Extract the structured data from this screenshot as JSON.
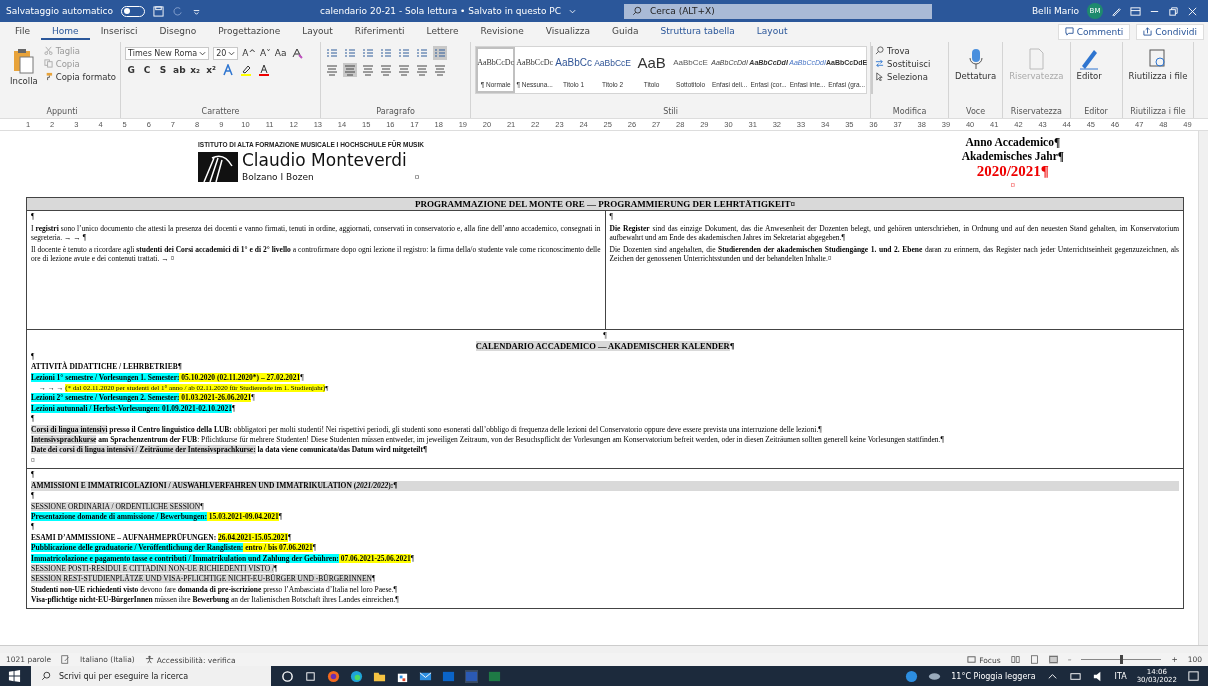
{
  "title_bar": {
    "autosave_label": "Salvataggio automatico",
    "autosave_on": false,
    "document_title": "calendario 20-21 - Sola lettura • Salvato in questo PC",
    "search_placeholder": "Cerca (ALT+X)",
    "user_name": "Belli Mario",
    "user_initials": "BM"
  },
  "tabs": [
    {
      "label": "File",
      "selected": false,
      "kind": "normal"
    },
    {
      "label": "Home",
      "selected": true,
      "kind": "normal"
    },
    {
      "label": "Inserisci",
      "selected": false,
      "kind": "normal"
    },
    {
      "label": "Disegno",
      "selected": false,
      "kind": "normal"
    },
    {
      "label": "Progettazione",
      "selected": false,
      "kind": "normal"
    },
    {
      "label": "Layout",
      "selected": false,
      "kind": "normal"
    },
    {
      "label": "Riferimenti",
      "selected": false,
      "kind": "normal"
    },
    {
      "label": "Lettere",
      "selected": false,
      "kind": "normal"
    },
    {
      "label": "Revisione",
      "selected": false,
      "kind": "normal"
    },
    {
      "label": "Visualizza",
      "selected": false,
      "kind": "normal"
    },
    {
      "label": "Guida",
      "selected": false,
      "kind": "normal"
    },
    {
      "label": "Struttura tabella",
      "selected": false,
      "kind": "contextual"
    },
    {
      "label": "Layout",
      "selected": false,
      "kind": "contextual"
    }
  ],
  "tab_actions": {
    "comments": "Commenti",
    "share": "Condividi"
  },
  "ribbon": {
    "clipboard": {
      "paste": "Incolla",
      "cut": "Taglia",
      "copy": "Copia",
      "format_painter": "Copia formato",
      "group": "Appunti"
    },
    "font": {
      "family": "Times New Roma",
      "size": "20",
      "grow": "A^",
      "shrink": "A˅",
      "case": "Aa",
      "format_buttons": [
        "G",
        "C",
        "S",
        "ab",
        "x₂",
        "x²"
      ],
      "group": "Carattere"
    },
    "paragraph": {
      "group": "Paragrafo"
    },
    "styles": {
      "group": "Stili",
      "items": [
        {
          "preview": "AaBbCcDc",
          "name": "¶ Normale",
          "selected": true,
          "kind": "serif"
        },
        {
          "preview": "AaBbCcDc",
          "name": "¶ Nessuna...",
          "selected": false,
          "kind": "serif"
        },
        {
          "preview": "AaBbCc",
          "name": "Titolo 1",
          "selected": false,
          "kind": "heading"
        },
        {
          "preview": "AaBbCcE",
          "name": "Titolo 2",
          "selected": false,
          "kind": "heading2"
        },
        {
          "preview": "AaB",
          "name": "Titolo",
          "selected": false,
          "kind": "title"
        },
        {
          "preview": "AaBbCcE",
          "name": "Sottotitolo",
          "selected": false,
          "kind": "subtitle"
        },
        {
          "preview": "AaBbCcDdI",
          "name": "Enfasi deli...",
          "selected": false,
          "kind": "italic"
        },
        {
          "preview": "AaBbCcDdI",
          "name": "Enfasi (cor...",
          "selected": false,
          "kind": "bolditalic"
        },
        {
          "preview": "AaBbCcDdI",
          "name": "Enfasi inte...",
          "selected": false,
          "kind": "intense"
        },
        {
          "preview": "AaBbCcDdE",
          "name": "Enfasi (gra...",
          "selected": false,
          "kind": "strong"
        }
      ]
    },
    "editing": {
      "group": "Modifica",
      "find": "Trova",
      "replace": "Sostituisci",
      "select": "Seleziona"
    },
    "big_buttons": [
      {
        "label": "Dettatura",
        "group": "Voce",
        "disabled": false,
        "kind": "mic"
      },
      {
        "label": "Riservatezza",
        "group": "Riservatezza",
        "disabled": true,
        "kind": "sensitivity"
      },
      {
        "label": "Editor",
        "group": "Editor",
        "disabled": false,
        "kind": "editor"
      },
      {
        "label": "Riutilizza i file",
        "group": "Riutilizza i file",
        "disabled": false,
        "kind": "reuse"
      }
    ]
  },
  "ruler": [
    "1",
    "2",
    "3",
    "4",
    "5",
    "6",
    "7",
    "8",
    "9",
    "10",
    "11",
    "12",
    "13",
    "14",
    "15",
    "16",
    "17",
    "18",
    "19",
    "20",
    "21",
    "22",
    "23",
    "24",
    "25",
    "26",
    "27",
    "28",
    "29",
    "30",
    "31",
    "32",
    "33",
    "34",
    "35",
    "36",
    "37",
    "38",
    "39",
    "40",
    "41",
    "42",
    "43",
    "44",
    "45",
    "46",
    "47",
    "48",
    "49"
  ],
  "document": {
    "header": {
      "institute": "ISTITUTO DI ALTA FORMAZIONE MUSICALE I HOCHSCHULE FÜR MUSIK",
      "logo_name": "Claudio Monteverdi",
      "logo_city": "Bolzano I Bozen",
      "cell_mark": "¤",
      "year_lines": [
        "Anno Accademico¶",
        "Akademisches Jahr¶"
      ],
      "year": "2020/2021¶",
      "year_cell_mark": "¤"
    },
    "table1": {
      "heading": "PROGRAMMAZIONE DEL MONTE ORE — PROGRAMMIERUNG DER LEHRTÄTIGKEIT¤",
      "left": [
        "¶",
        "I **registri** sono l’unico documento che attesti la presenza dei docenti e vanno firmati, tenuti in ordine, aggiornati, conservati in conservatorio e, alla fine dell’anno accademico, consegnati in segreteria. → → ¶",
        "Il docente è tenuto a ricordare agli **studenti dei Corsi accademici di 1° e di 2° livello** a controfirmare dopo ogni lezione il registro: la firma della/o studente vale come riconoscimento delle ore di lezione avute e dei contenuti trattati. → ¤"
      ],
      "right": [
        "¶",
        "**Die Register** sind das einzige Dokument, das die Anwesenheit der Dozenten belegt, und gehören unterschrieben, in Ordnung und auf den neuesten Stand gehalten, im Konservatorium aufbewahrt und am Ende des akademischen Jahres im Sekretariat abgegeben.¶",
        "Die Dozenten sind angehalten, die **Studierenden der akademischen Studiengänge 1. und 2. Ebene** daran zu erinnern, das Register nach jeder Unterrichtseinheit gegenzuzeichnen, als Zeichen der genossenen Unterrichtsstunden und der behandelten Inhalte.¤"
      ]
    },
    "sections": [
      {
        "lines": [
          {
            "kind": "center",
            "segments": [
              {
                "text": "¶"
              }
            ]
          },
          {
            "kind": "title",
            "segments": [
              {
                "text": "**CALENDARIO ACCADEMICO — AKADEMISCHER KALENDER**",
                "color": "#d9d9d9"
              },
              {
                "text": "**¶**"
              }
            ]
          },
          {
            "kind": "body",
            "segments": [
              {
                "text": "¶"
              }
            ]
          },
          {
            "kind": "body",
            "segments": [
              {
                "text": "**ATTIVITÀ DIDATTICHE / LEHRBETRIEB¶**"
              }
            ]
          },
          {
            "kind": "body",
            "segments": [
              {
                "text": "**Lezioni 1° semestre / Vorlesungen 1. Semester:**",
                "color": "#00ffff"
              },
              {
                "text": " **05.10.2020 (02.11.2020*) – 27.02.2021**",
                "color": "#ffff00"
              },
              {
                "text": "¶"
              }
            ]
          },
          {
            "kind": "note",
            "segments": [
              {
                "text": "→ → → "
              },
              {
                "text": "(* dal 02.11.2020 per studenti del 1° anno / ab 02.11.2020 für Studierende im 1. Studienjahr)",
                "color": "#ffff00"
              },
              {
                "text": "¶"
              }
            ]
          },
          {
            "kind": "body",
            "segments": [
              {
                "text": "**Lezioni 2° semestre / Vorlesungen 2. Semester:**",
                "color": "#00ffff"
              },
              {
                "text": " **01.03.2021-26.06.2021**",
                "color": "#ffff00"
              },
              {
                "text": "¶"
              }
            ]
          },
          {
            "kind": "body",
            "segments": [
              {
                "text": "**Lezioni autunnali / Herbst-Vorlesungen: 01.09.2021-02.10.2021**",
                "color": "#00ffff"
              },
              {
                "text": "¶"
              }
            ]
          },
          {
            "kind": "body",
            "segments": [
              {
                "text": "¶"
              }
            ]
          },
          {
            "kind": "body",
            "segments": [
              {
                "text": "**Corsi di lingua intensivi**",
                "color": "#d9d9d9"
              },
              {
                "text": " **presso il Centro linguistico della LUB:** obbligatori per molti studenti! Nei rispettivi periodi, gli studenti sono esonerati dall’obbligo di frequenza delle lezioni del Conservatorio oppure deve essere prevista una interruzione delle lezioni.¶"
              }
            ]
          },
          {
            "kind": "body",
            "segments": [
              {
                "text": "**Intensivsprachkurse**",
                "color": "#d9d9d9"
              },
              {
                "text": " **am Sprachenzentrum der FUB**: Pflichtkurse für mehrere Studenten! Diese Studenten müssen entweder, im jeweiligen Zeitraum, von der Besuchspflicht der Vorlesungen am Konservatorium befreit werden, oder in diesen Zeiträumen sollten generell keine Vorlesungen stattfinden.¶"
              }
            ]
          },
          {
            "kind": "body",
            "segments": [
              {
                "text": "**Date dei corsi di lingua intensivi / Zeiträume der Intensivsprachkurse:**",
                "color": "#d9d9d9"
              },
              {
                "text": " **la data viene comunicata/das Datum wird mitgeteilt¶**"
              }
            ]
          },
          {
            "kind": "body",
            "segments": [
              {
                "text": "¤"
              }
            ]
          }
        ]
      },
      {
        "lines": [
          {
            "kind": "body",
            "segments": [
              {
                "text": "¶"
              }
            ]
          },
          {
            "kind": "banner",
            "segments": [
              {
                "text": "**AMMISSIONI E IMMATRICOLAZIONI / AUSWAHLVERFAHREN UND IMMATRIKULATION (*2021/2022*):¶**",
                "color": "#d9d9d9"
              }
            ]
          },
          {
            "kind": "body",
            "segments": [
              {
                "text": "¶"
              }
            ]
          },
          {
            "kind": "body",
            "segments": [
              {
                "text": "SESSIONE ORDINARIA / ORDENTLICHE SESSION",
                "color": "#d9d9d9"
              },
              {
                "text": "¶"
              }
            ]
          },
          {
            "kind": "body",
            "segments": [
              {
                "text": "**Presentazione domande di ammissione / Bewerbungen:**",
                "color": "#00ffff"
              },
              {
                "text": " **15.03.2021-09.04.2021**",
                "color": "#ffff00"
              },
              {
                "text": "¶"
              }
            ]
          },
          {
            "kind": "body",
            "segments": [
              {
                "text": "¶"
              }
            ]
          },
          {
            "kind": "body",
            "segments": [
              {
                "text": "**ESAMI D’AMMISSIONE – AUFNAHMEPRÜFUNGEN:** "
              },
              {
                "text": "**26.04.2021-15.05.2021**",
                "color": "#ffff00"
              },
              {
                "text": "¶"
              }
            ]
          },
          {
            "kind": "body",
            "segments": [
              {
                "text": "**Pubblicazione delle graduatorie / Veröffentlichung der Ranglisten:**",
                "color": "#00ffff"
              },
              {
                "text": " **entro / bis 07.06.2021**",
                "color": "#ffff00"
              },
              {
                "text": "¶"
              }
            ]
          },
          {
            "kind": "body",
            "segments": [
              {
                "text": "**Immatricolazione e pagamento tasse e contributi / Immatrikulation und Zahlung der Gebühren:**",
                "color": "#00ffff"
              },
              {
                "text": " **07.06.2021-25.06.2021**",
                "color": "#ffff00"
              },
              {
                "text": "¶"
              }
            ]
          },
          {
            "kind": "body",
            "segments": [
              {
                "text": "SESSIONE POSTI-RESIDUI E CITTADINI NON-UE RICHIEDENTI VISTO /",
                "color": "#d9d9d9"
              },
              {
                "text": "¶"
              }
            ]
          },
          {
            "kind": "body",
            "segments": [
              {
                "text": "SESSION REST-STUDIENPLÄTZE UND VISA-PFLICHTIGE NICHT-EU-BÜRGER UND -BÜRGERINNEN",
                "color": "#d9d9d9"
              },
              {
                "text": "¶"
              }
            ]
          },
          {
            "kind": "body",
            "segments": [
              {
                "text": "**Studenti non-UE richiedenti visto** devono fare **domanda di pre-iscrizione** presso l’Ambasciata d’Italia nel loro Paese.¶"
              }
            ]
          },
          {
            "kind": "body",
            "segments": [
              {
                "text": "**Visa-pflichtige nicht-EU-BürgerInnen** müssen ihre **Bewerbung** an der Italienischen Botschaft ihres Landes einreichen.¶"
              }
            ]
          }
        ]
      }
    ]
  },
  "status_bar": {
    "words": "1021 parole",
    "language": "Italiano (Italia)",
    "accessibility": "Accessibilità: verifica",
    "focus": "Focus",
    "zoom_out": "–",
    "level": 0.5,
    "zoom_in": "+",
    "zoom": "100"
  },
  "taskbar": {
    "search_placeholder": "Scrivi qui per eseguire la ricerca",
    "weather": "11°C Pioggia leggera",
    "language": "ITA",
    "time": "14:06",
    "date": "30/03/2022"
  }
}
